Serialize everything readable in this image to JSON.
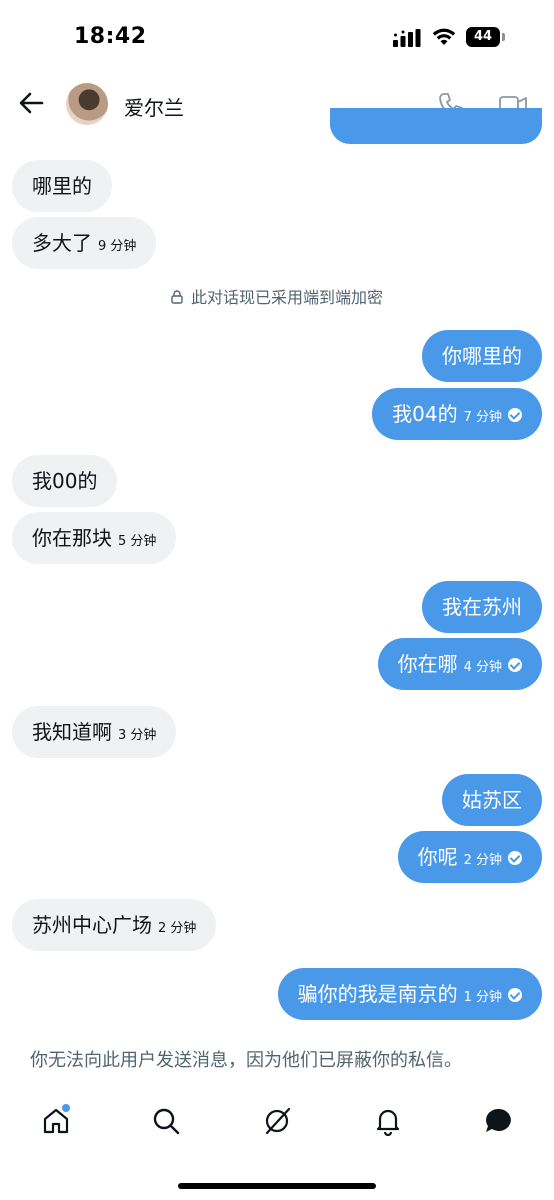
{
  "status": {
    "time": "18:42",
    "battery": "44"
  },
  "header": {
    "contact_name": "爱尔兰"
  },
  "encryption_notice": "此对话现已采用端到端加密",
  "messages": [
    {
      "text": "哪里的",
      "time": ""
    },
    {
      "text": "多大了",
      "time": "9 分钟"
    },
    {
      "text": "你哪里的",
      "time": ""
    },
    {
      "text": "我04的",
      "time": "7 分钟"
    },
    {
      "text": "我00的",
      "time": ""
    },
    {
      "text": "你在那块",
      "time": "5 分钟"
    },
    {
      "text": "我在苏州",
      "time": ""
    },
    {
      "text": "你在哪",
      "time": "4 分钟"
    },
    {
      "text": "我知道啊",
      "time": "3 分钟"
    },
    {
      "text": "姑苏区",
      "time": ""
    },
    {
      "text": "你呢",
      "time": "2 分钟"
    },
    {
      "text": "苏州中心广场",
      "time": "2 分钟"
    },
    {
      "text": "骗你的我是南京的",
      "time": "1 分钟"
    }
  ],
  "blocked_notice": "你无法向此用户发送消息，因为他们已屏蔽你的私信。",
  "nav": {
    "items": [
      "home-icon",
      "search-icon",
      "grok-icon",
      "notifications-icon",
      "messages-icon"
    ],
    "home_has_notification_dot": true
  },
  "colors": {
    "accent": "#4a99e9",
    "received_bubble": "#eff1f3",
    "muted_text": "#536471"
  }
}
